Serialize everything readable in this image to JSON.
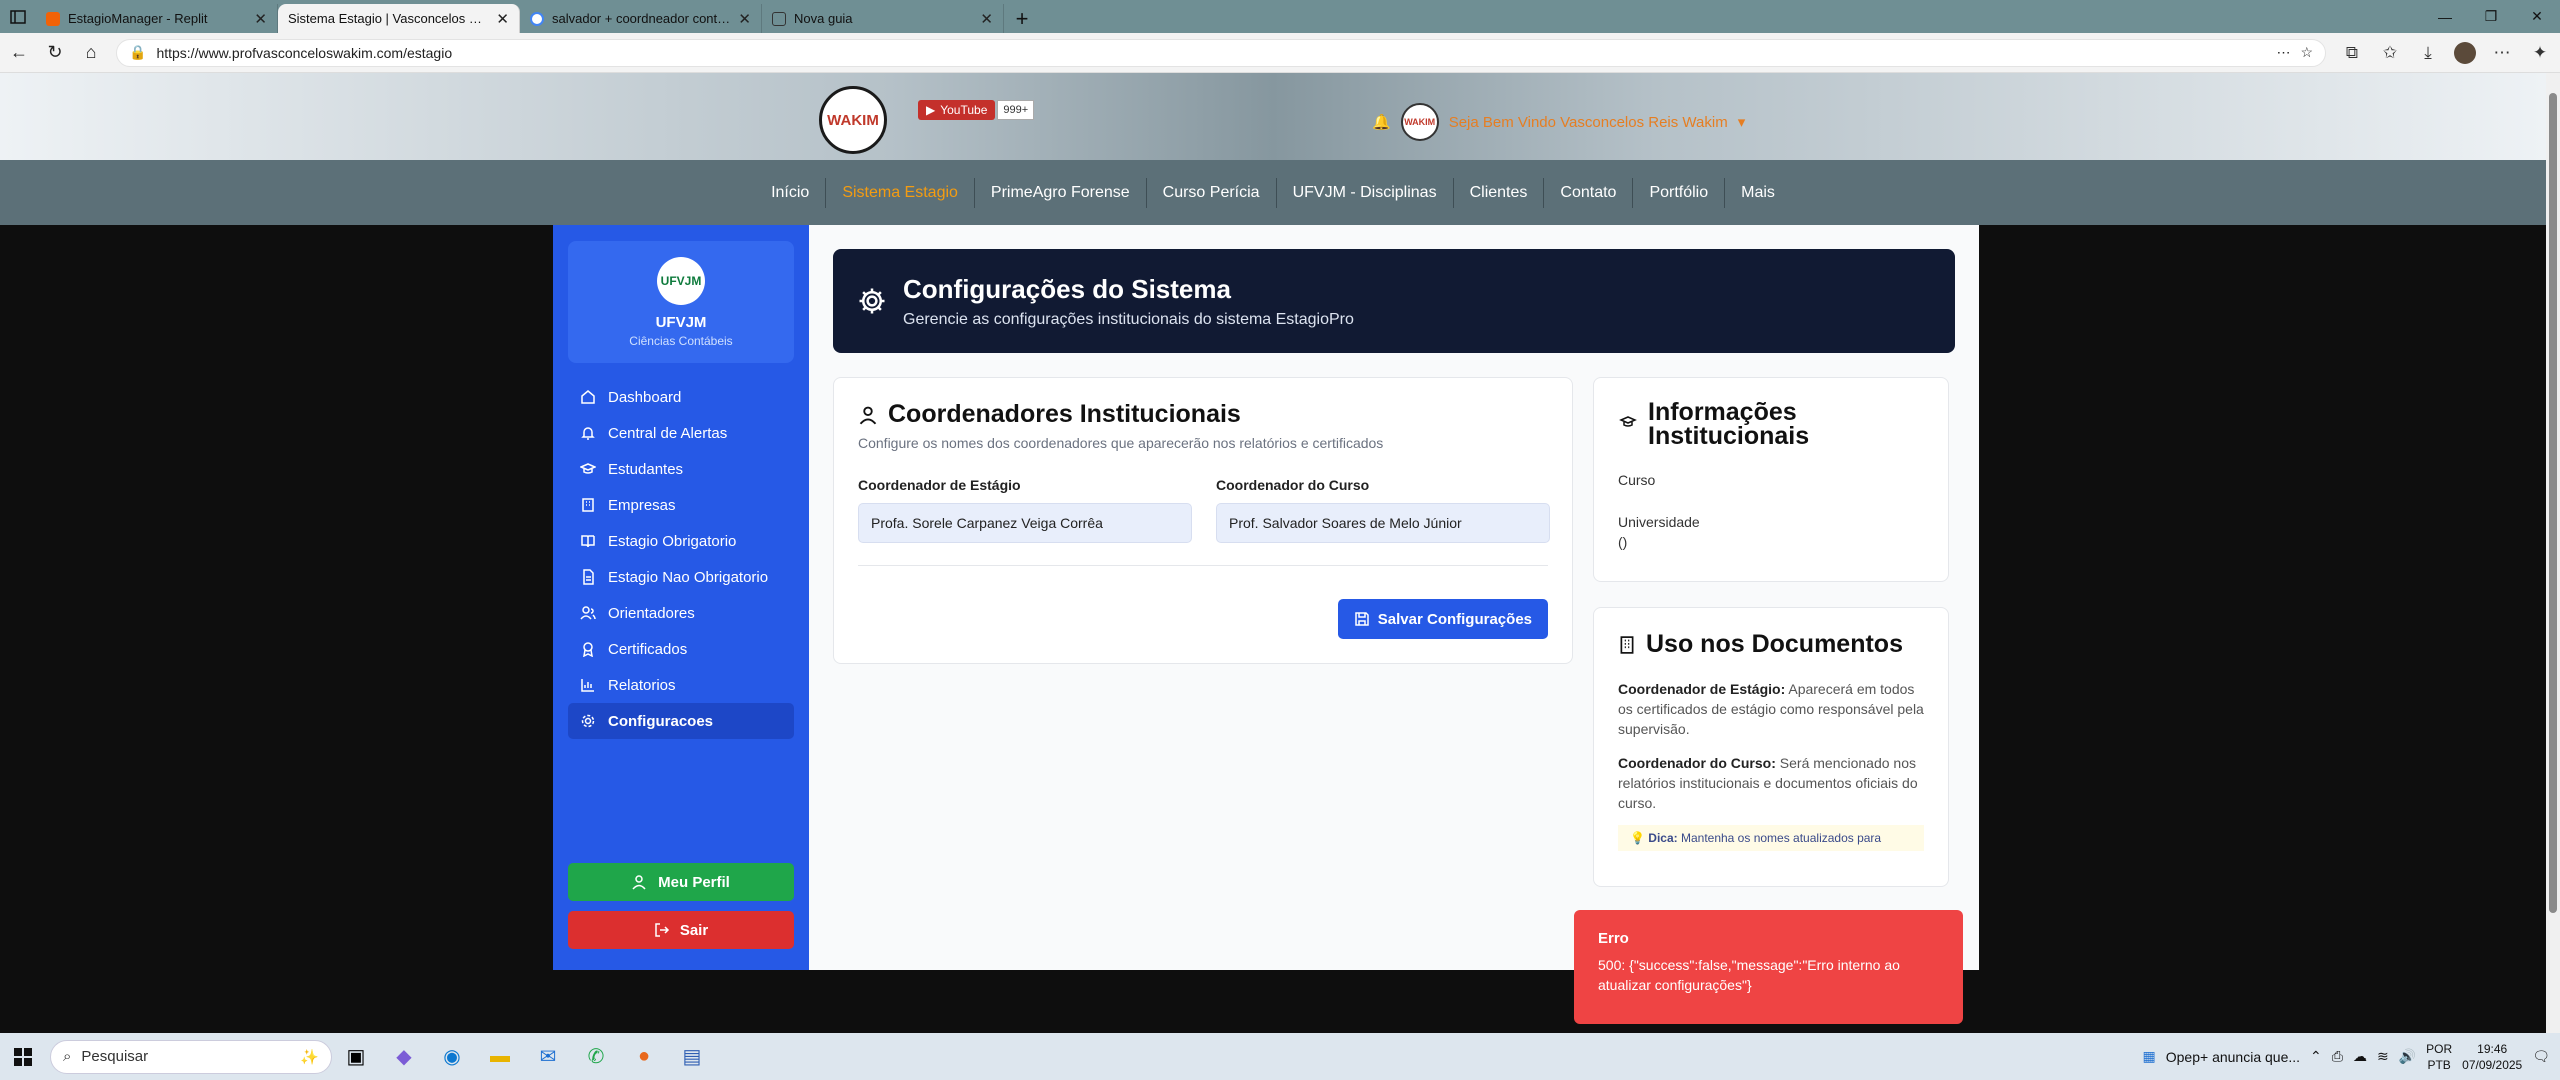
{
  "browser": {
    "tabs": [
      {
        "title": "EstagioManager - Replit",
        "active": false
      },
      {
        "title": "Sistema Estagio | Vasconcelos Wakim",
        "active": true
      },
      {
        "title": "salvador + coordneador contábeis",
        "active": false
      },
      {
        "title": "Nova guia",
        "active": false
      }
    ],
    "url": "https://www.profvasconceloswakim.com/estagio"
  },
  "site": {
    "youtube_label": "YouTube",
    "youtube_count": "999+",
    "welcome": "Seja Bem Vindo Vasconcelos Reis Wakim",
    "logo_text": "WAKIM",
    "menu": [
      "Início",
      "Sistema Estagio",
      "PrimeAgro Forense",
      "Curso Perícia",
      "UFVJM - Disciplinas",
      "Clientes",
      "Contato",
      "Portfólio",
      "Mais"
    ],
    "active_menu": "Sistema Estagio"
  },
  "sidebar": {
    "logo_text": "UFVJM",
    "institution": "UFVJM",
    "course": "Ciências Contábeis",
    "items": [
      {
        "label": "Dashboard",
        "icon": "home-icon"
      },
      {
        "label": "Central de Alertas",
        "icon": "bell-icon"
      },
      {
        "label": "Estudantes",
        "icon": "graduation-cap-icon"
      },
      {
        "label": "Empresas",
        "icon": "building-icon"
      },
      {
        "label": "Estagio Obrigatorio",
        "icon": "book-icon"
      },
      {
        "label": "Estagio Nao Obrigatorio",
        "icon": "file-icon"
      },
      {
        "label": "Orientadores",
        "icon": "users-icon"
      },
      {
        "label": "Certificados",
        "icon": "award-icon"
      },
      {
        "label": "Relatorios",
        "icon": "bar-chart-icon"
      },
      {
        "label": "Configuracoes",
        "icon": "gear-icon"
      }
    ],
    "active": "Configuracoes",
    "profile_button": "Meu Perfil",
    "logout_button": "Sair"
  },
  "hero": {
    "title": "Configurações do Sistema",
    "subtitle": "Gerencie as configurações institucionais do sistema EstagioPro"
  },
  "coordinators": {
    "title": "Coordenadores Institucionais",
    "subtitle": "Configure os nomes dos coordenadores que aparecerão nos relatórios e certificados",
    "stage_label": "Coordenador de Estágio",
    "stage_value": "Profa. Sorele Carpanez Veiga Corrêa",
    "course_label": "Coordenador do Curso",
    "course_value": "Prof. Salvador Soares de Melo Júnior",
    "save_button": "Salvar Configurações"
  },
  "info": {
    "title": "Informações Institucionais",
    "course_label": "Curso",
    "university_label": "Universidade",
    "university_value": "()"
  },
  "docs": {
    "title": "Uso nos Documentos",
    "p1_bold": "Coordenador de Estágio:",
    "p1_text": " Aparecerá em todos os certificados de estágio como responsável pela supervisão.",
    "p2_bold": "Coordenador do Curso:",
    "p2_text": " Será mencionado nos relatórios institucionais e documentos oficiais do curso.",
    "tip_bold": "Dica:",
    "tip_text": " Mantenha os nomes atualizados para"
  },
  "toast": {
    "title": "Erro",
    "message": "500: {\"success\":false,\"message\":\"Erro interno ao atualizar configurações\"}"
  },
  "taskbar": {
    "search_placeholder": "Pesquisar",
    "news": "Opep+ anuncia que...",
    "lang1": "POR",
    "lang2": "PTB",
    "time": "19:46",
    "date": "07/09/2025"
  },
  "colors": {
    "sidebar": "#2659e6",
    "hero": "#111a33",
    "error": "#ef4444",
    "profile": "#1fa64a",
    "logout": "#dc2f2f"
  }
}
